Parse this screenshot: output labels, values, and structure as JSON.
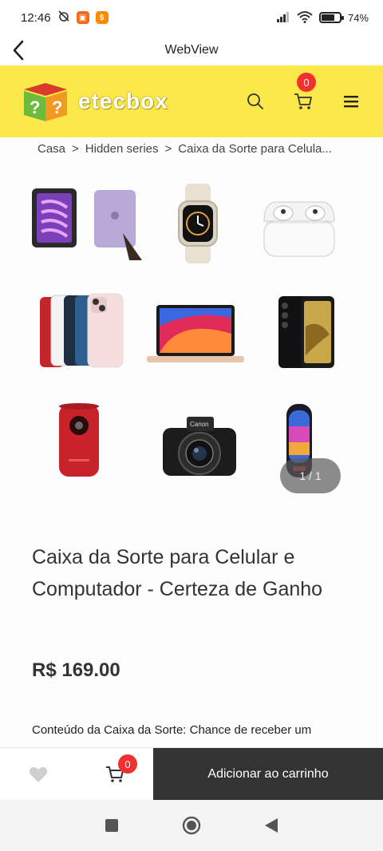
{
  "status_bar": {
    "time": "12:46",
    "battery": "74%",
    "battery_level": 0.74
  },
  "webview": {
    "title": "WebView"
  },
  "header": {
    "logo_text": "etecbox",
    "cart_count": "0"
  },
  "breadcrumb": {
    "items": [
      "Casa",
      "Hidden series",
      "Caixa da Sorte para Celula..."
    ],
    "separator": ">"
  },
  "gallery": {
    "products": [
      "ipad-mini",
      "apple-watch",
      "airpods-pro",
      "iphone-13",
      "macbook-air",
      "galaxy-s22",
      "projector",
      "canon-camera",
      "jbl-pulse-speaker"
    ],
    "counter": "1 / 1"
  },
  "product": {
    "title": "Caixa da Sorte para Celular e Computador - Certeza de Ganho",
    "price": "R$ 169.00",
    "description": "Conteúdo da Caixa da Sorte: Chance de receber um"
  },
  "bottom_bar": {
    "cart_count": "0",
    "add_to_cart_label": "Adicionar ao carrinho"
  },
  "colors": {
    "header_bg": "#fbe94a",
    "badge": "#f23030",
    "add_button_bg": "#333333"
  }
}
